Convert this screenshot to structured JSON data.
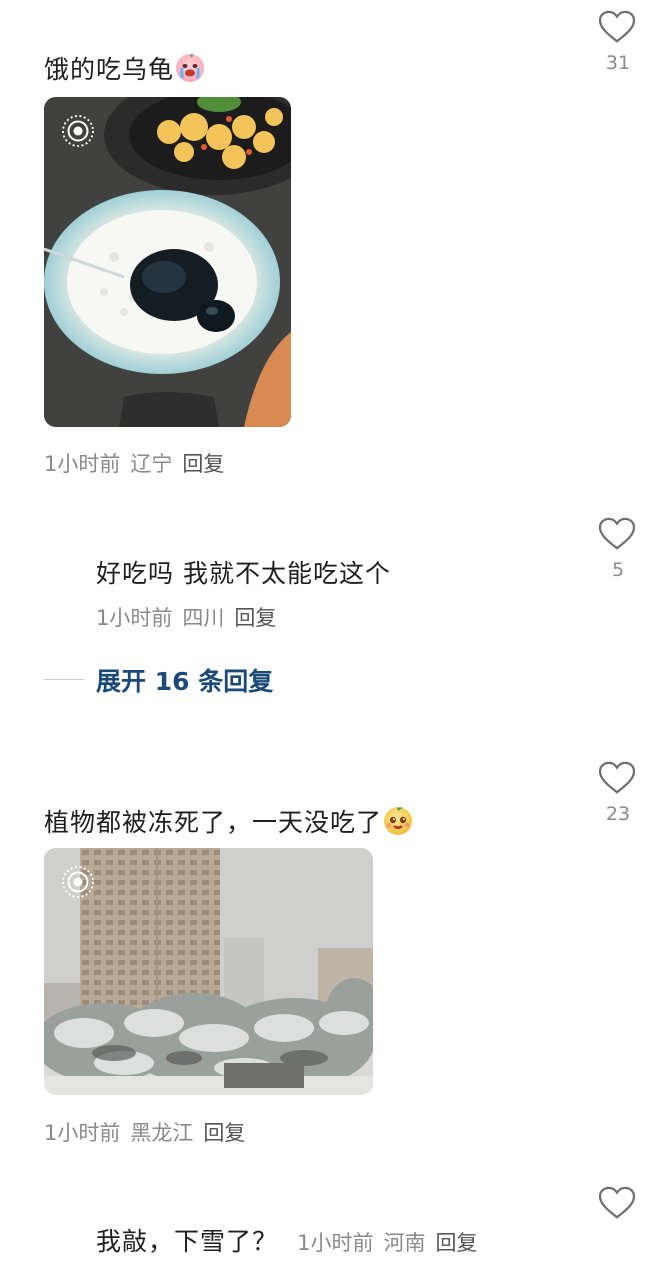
{
  "comments": [
    {
      "text": "饿的吃乌龟",
      "emoji": "crying-face-emoji",
      "meta": {
        "time": "1小时前",
        "location": "辽宁",
        "reply": "回复"
      },
      "likes": "31",
      "photo": "turtle-jelly-dessert-photo"
    },
    {
      "text": "好吃吗 我就不太能吃这个",
      "meta": {
        "time": "1小时前",
        "location": "四川",
        "reply": "回复"
      },
      "likes": "5"
    },
    {
      "text": "植物都被冻死了，一天没吃了",
      "emoji": "smiling-fruit-emoji",
      "meta": {
        "time": "1小时前",
        "location": "黑龙江",
        "reply": "回复"
      },
      "likes": "23",
      "photo": "snowy-city-photo"
    },
    {
      "text": "我敲，下雪了？",
      "meta": {
        "time": "1小时前",
        "location": "河南",
        "reply": "回复"
      },
      "likes": ""
    }
  ],
  "expand": {
    "label": "展开 16 条回复"
  },
  "colors": {
    "accent": "#1a4a7a",
    "meta": "#8a8a8a",
    "heart": "#6f6f6f"
  }
}
